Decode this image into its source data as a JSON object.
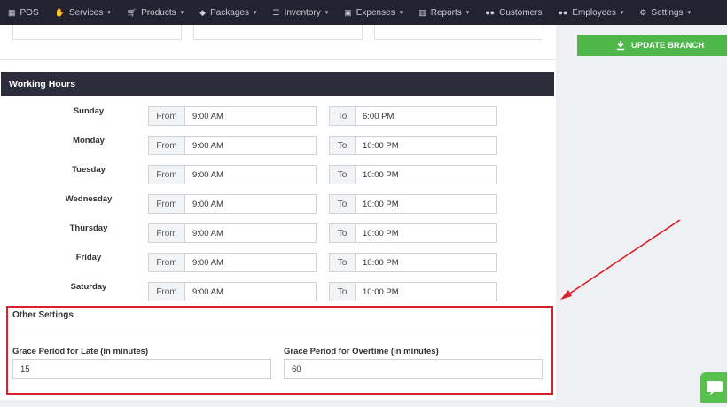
{
  "nav": {
    "items": [
      {
        "label": "POS",
        "icon": "calculator-icon",
        "dropdown": false
      },
      {
        "label": "Services",
        "icon": "hand-icon",
        "dropdown": true
      },
      {
        "label": "Products",
        "icon": "cart-icon",
        "dropdown": true
      },
      {
        "label": "Packages",
        "icon": "tags-icon",
        "dropdown": true
      },
      {
        "label": "Inventory",
        "icon": "list-icon",
        "dropdown": true
      },
      {
        "label": "Expenses",
        "icon": "receipt-icon",
        "dropdown": true
      },
      {
        "label": "Reports",
        "icon": "bar-chart-icon",
        "dropdown": true
      },
      {
        "label": "Customers",
        "icon": "users-icon",
        "dropdown": false
      },
      {
        "label": "Employees",
        "icon": "user-group-icon",
        "dropdown": true
      },
      {
        "label": "Settings",
        "icon": "gear-icon",
        "dropdown": true
      }
    ]
  },
  "working_hours": {
    "title": "Working Hours",
    "from_label": "From",
    "to_label": "To",
    "days": [
      {
        "day": "Sunday",
        "from": "9:00 AM",
        "to": "6:00 PM"
      },
      {
        "day": "Monday",
        "from": "9:00 AM",
        "to": "10:00 PM"
      },
      {
        "day": "Tuesday",
        "from": "9:00 AM",
        "to": "10:00 PM"
      },
      {
        "day": "Wednesday",
        "from": "9:00 AM",
        "to": "10:00 PM"
      },
      {
        "day": "Thursday",
        "from": "9:00 AM",
        "to": "10:00 PM"
      },
      {
        "day": "Friday",
        "from": "9:00 AM",
        "to": "10:00 PM"
      },
      {
        "day": "Saturday",
        "from": "9:00 AM",
        "to": "10:00 PM"
      }
    ]
  },
  "other_settings": {
    "title": "Other Settings",
    "grace_late_label": "Grace Period for Late (in minutes)",
    "grace_late_value": "15",
    "grace_overtime_label": "Grace Period for Overtime (in minutes)",
    "grace_overtime_value": "60"
  },
  "sidebar": {
    "update_label": "UPDATE BRANCH",
    "update_icon": "download-icon"
  },
  "colors": {
    "nav_bg": "#23232f",
    "section_bar": "#2c2c3a",
    "update_green": "#4eb749",
    "highlight_red": "#d9202a",
    "chat_green": "#58c04d"
  }
}
